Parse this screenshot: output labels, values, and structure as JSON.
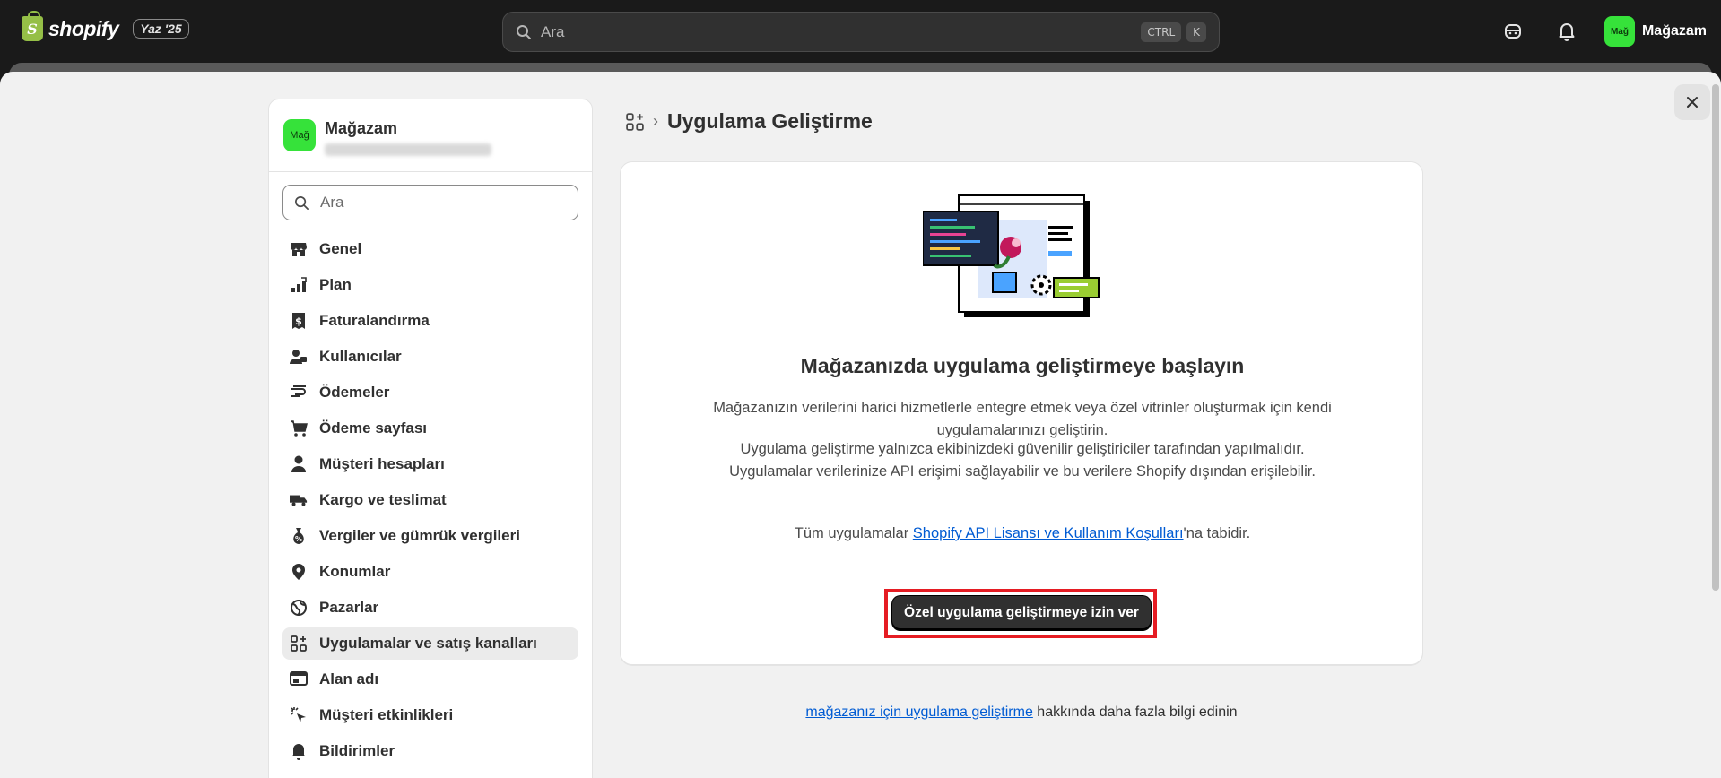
{
  "topbar": {
    "logo_text": "shopify",
    "logo_mark": "S",
    "edition": "Yaz '25",
    "search_placeholder": "Ara",
    "shortcut_keys": [
      "CTRL",
      "K"
    ],
    "store_avatar": "Mağ",
    "store_name": "Mağazam",
    "icons": [
      "sidekick-icon",
      "bell-icon"
    ]
  },
  "sidebar": {
    "store_avatar": "Mağ",
    "store_name": "Mağazam",
    "search_placeholder": "Ara",
    "items": [
      {
        "label": "Genel",
        "icon": "store-icon"
      },
      {
        "label": "Plan",
        "icon": "plan-icon"
      },
      {
        "label": "Faturalandırma",
        "icon": "billing-icon"
      },
      {
        "label": "Kullanıcılar",
        "icon": "users-icon"
      },
      {
        "label": "Ödemeler",
        "icon": "payments-icon"
      },
      {
        "label": "Ödeme sayfası",
        "icon": "cart-icon"
      },
      {
        "label": "Müşteri hesapları",
        "icon": "person-icon"
      },
      {
        "label": "Kargo ve teslimat",
        "icon": "truck-icon"
      },
      {
        "label": "Vergiler ve gümrük vergileri",
        "icon": "tax-icon"
      },
      {
        "label": "Konumlar",
        "icon": "location-icon"
      },
      {
        "label": "Pazarlar",
        "icon": "globe-icon"
      },
      {
        "label": "Uygulamalar ve satış kanalları",
        "icon": "apps-icon",
        "active": true
      },
      {
        "label": "Alan adı",
        "icon": "domain-icon"
      },
      {
        "label": "Müşteri etkinlikleri",
        "icon": "cursor-icon"
      },
      {
        "label": "Bildirimler",
        "icon": "bell-icon"
      }
    ]
  },
  "main": {
    "breadcrumb_title": "Uygulama Geliştirme",
    "card": {
      "title": "Mağazanızda uygulama geliştirmeye başlayın",
      "paragraph1": "Mağazanızın verilerini harici hizmetlerle entegre etmek veya özel vitrinler oluşturmak için kendi uygulamalarınızı geliştirin.",
      "paragraph2": "Uygulama geliştirme yalnızca ekibinizdeki güvenilir geliştiriciler tarafından yapılmalıdır. Uygulamalar verilerinize API erişimi sağlayabilir ve bu verilere Shopify dışından erişilebilir.",
      "terms_prefix": "Tüm uygulamalar ",
      "terms_link": "Shopify API Lisansı ve Kullanım Koşulları",
      "terms_suffix": "'na tabidir.",
      "cta_label": "Özel uygulama geliştirmeye izin ver"
    },
    "footer_link": "mağazanız için uygulama geliştirme",
    "footer_suffix": " hakkında daha fazla bilgi edinin"
  },
  "colors": {
    "accent_link": "#005bd3",
    "highlight_border": "#e51c23",
    "avatar_bg": "#36e23a",
    "topbar_bg": "#1a1a1a"
  }
}
